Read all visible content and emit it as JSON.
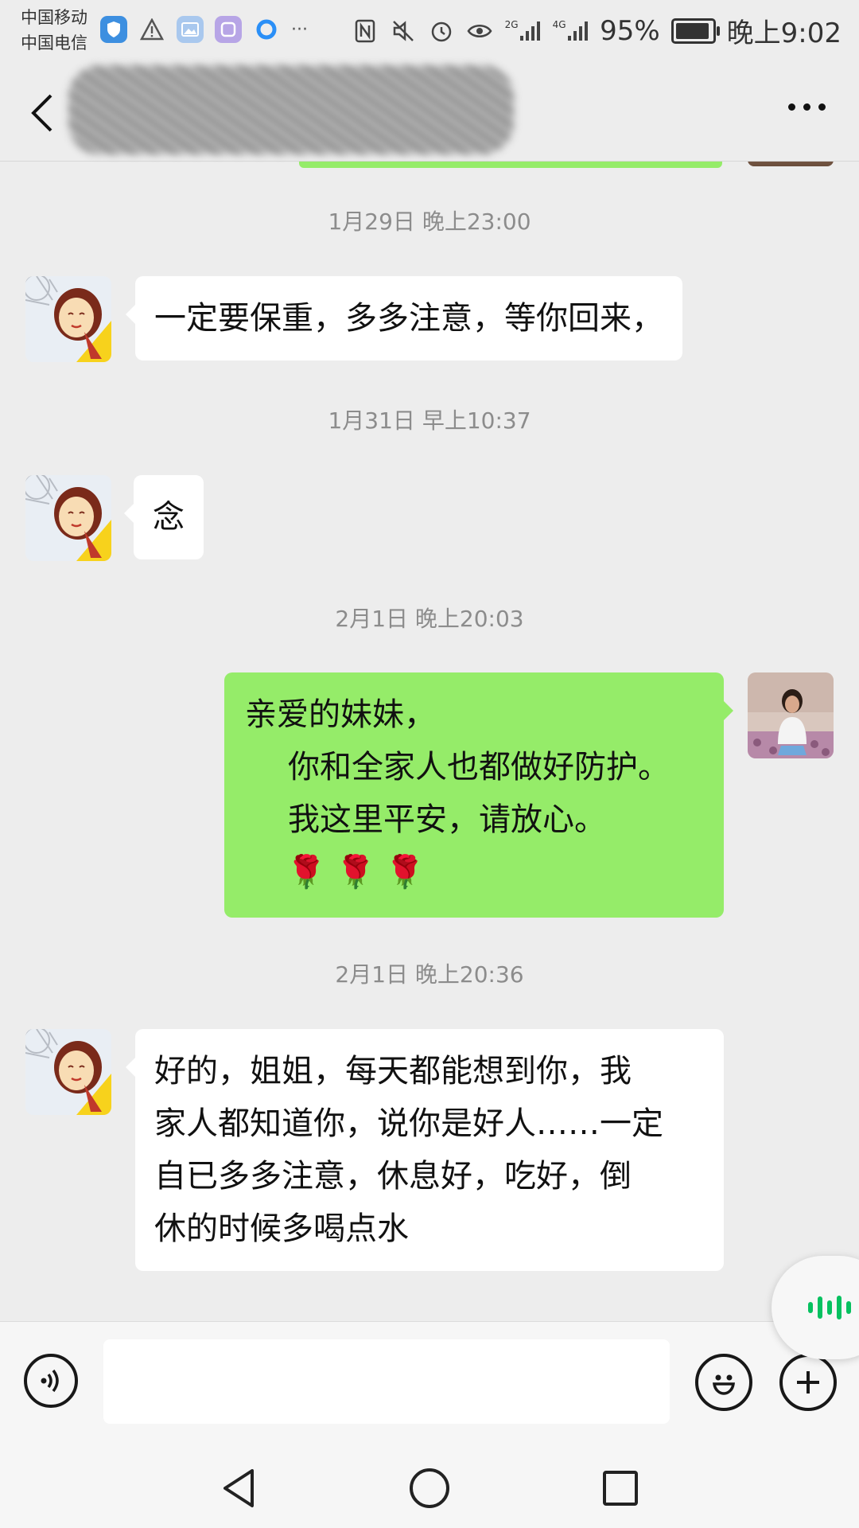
{
  "status_bar": {
    "carrier_1": "中国移动",
    "carrier_2": "中国电信",
    "overflow": "···",
    "signal_2g": "2G",
    "signal_4g": "4G",
    "battery_percent": "95%",
    "battery_level": 0.95,
    "time": "晚上9:02"
  },
  "header": {
    "title": "",
    "back_icon": "chevron-left-icon",
    "more_icon": "more-dots-icon"
  },
  "messages": [
    {
      "type": "timestamp",
      "text": "1月29日 晚上23:00"
    },
    {
      "type": "incoming",
      "lines": [
        "一定要保重，多多注意，等你回来，"
      ]
    },
    {
      "type": "timestamp",
      "text": "1月31日 早上10:37"
    },
    {
      "type": "incoming",
      "lines": [
        "念"
      ]
    },
    {
      "type": "timestamp",
      "text": "2月1日 晚上20:03"
    },
    {
      "type": "outgoing",
      "lines": [
        "亲爱的妹妹，",
        "你和全家人也都做好防护。",
        "我这里平安，请放心。"
      ],
      "emoji": [
        "🌹",
        "🌹",
        "🌹"
      ]
    },
    {
      "type": "timestamp",
      "text": "2月1日 晚上20:36"
    },
    {
      "type": "incoming",
      "lines": [
        "好的，姐姐，每天都能想到你，我",
        "家人都知道你，说你是好人……一定",
        "自已多多注意，休息好，吃好，倒",
        "休的时候多喝点水"
      ]
    }
  ],
  "input_bar": {
    "voice_icon": "voice-input-icon",
    "text_value": "",
    "emoji_icon": "emoji-icon",
    "plus_icon": "plus-icon"
  },
  "floating": {
    "icon": "voice-wave-icon"
  },
  "nav": {
    "back_icon": "nav-back-icon",
    "home_icon": "nav-home-icon",
    "recents_icon": "nav-recents-icon"
  },
  "colors": {
    "outgoing_bubble": "#95ec69",
    "incoming_bubble": "#ffffff",
    "background": "#ededed",
    "accent": "#07c160"
  }
}
